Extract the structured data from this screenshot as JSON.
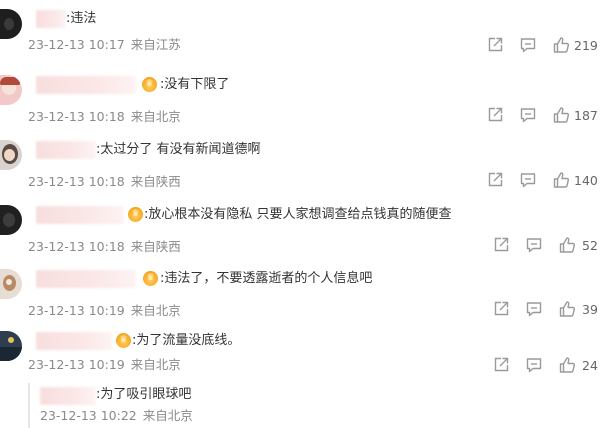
{
  "comments": [
    {
      "text": ":违法",
      "date": "23-12-13 10:17",
      "location": "来自江苏",
      "likes": "219"
    },
    {
      "text": ":没有下限了",
      "date": "23-12-13 10:18",
      "location": "来自北京",
      "likes": "187"
    },
    {
      "text": ":太过分了 有没有新闻道德啊",
      "date": "23-12-13 10:18",
      "location": "来自陕西",
      "likes": "140"
    },
    {
      "text": ":放心根本没有隐私 只要人家想调查给点钱真的随便查",
      "date": "23-12-13 10:18",
      "location": "来自陕西",
      "likes": "52"
    },
    {
      "text": ":违法了，不要透露逝者的个人信息吧",
      "date": "23-12-13 10:19",
      "location": "来自北京",
      "likes": "39"
    },
    {
      "text": ":为了流量没底线。",
      "date": "23-12-13 10:19",
      "location": "来自北京",
      "likes": "24"
    }
  ],
  "reply": {
    "text": ":为了吸引眼球吧",
    "date": "23-12-13 10:22",
    "location": "来自北京"
  },
  "icons": {
    "share": "share-icon",
    "comment": "comment-icon",
    "like": "thumbs-up-icon",
    "crown": "crown-badge-icon"
  },
  "colors": {
    "meta_gray": "#8a8a8a",
    "icon_gray": "#9a9a9a",
    "blur_pink": "#f8dede",
    "crown_gold": "#f5a623"
  }
}
